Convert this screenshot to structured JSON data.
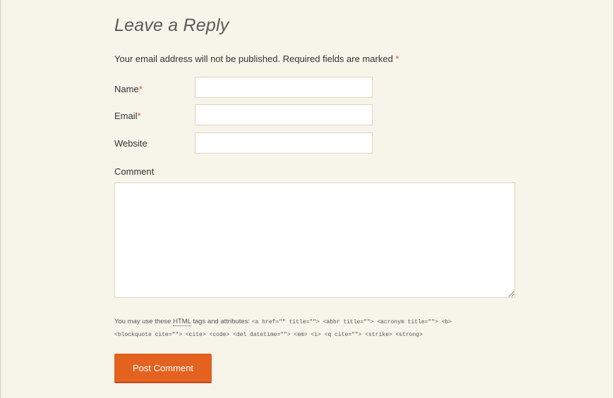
{
  "reply": {
    "title": "Leave a Reply",
    "notes": "Your email address will not be published. Required fields are marked",
    "required_mark": "*"
  },
  "fields": {
    "name": {
      "label": "Name",
      "required_mark": "*",
      "value": ""
    },
    "email": {
      "label": "Email",
      "required_mark": "*",
      "value": ""
    },
    "website": {
      "label": "Website",
      "value": ""
    },
    "comment": {
      "label": "Comment",
      "value": ""
    }
  },
  "allowed_tags": {
    "prefix": "You may use these",
    "abbr": "HTML",
    "suffix": "tags and attributes:",
    "line1": "<a href=\"\" title=\"\"> <abbr title=\"\"> <acronym title=\"\"> <b>",
    "line2": "<blockquote cite=\"\"> <cite> <code> <del datetime=\"\"> <em> <i> <q cite=\"\"> <strike> <strong>"
  },
  "submit": {
    "label": "Post Comment"
  },
  "colors": {
    "background": "#f7f4ea",
    "accent": "#e3621f",
    "required": "#e05a2a",
    "input_border": "#dcd5be"
  }
}
